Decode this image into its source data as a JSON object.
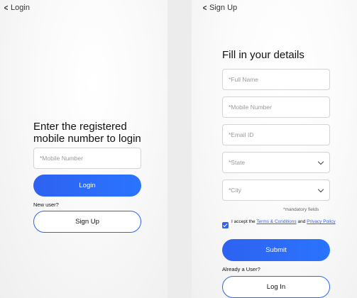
{
  "login": {
    "back_label": "Login",
    "heading": "Enter the registered mobile number to login",
    "mobile_placeholder": "*Mobile Number",
    "login_button": "Login",
    "new_user_text": "New user?",
    "signup_button": "Sign Up"
  },
  "signup": {
    "back_label": "Sign Up",
    "heading": "Fill in your details",
    "fields": {
      "full_name": "*Full Name",
      "mobile": "*Mobile Number",
      "email": "*Email ID",
      "state": "*State",
      "city": "*City"
    },
    "mandatory_note": "*mandatory fields",
    "terms": {
      "prefix": "I accept the ",
      "terms_link": "Terms & Conditions",
      "middle": " and ",
      "privacy_link": "Privacy Policy",
      "checked": true
    },
    "submit_button": "Submit",
    "already_user_text": "Already a User?",
    "login_button": "Log In"
  },
  "colors": {
    "accent": "#2e62f0",
    "background": "#ececec"
  },
  "icons": {
    "back": "chevron-left-icon",
    "select": "chevron-down-icon",
    "checkbox": "checkbox-checked-icon"
  }
}
